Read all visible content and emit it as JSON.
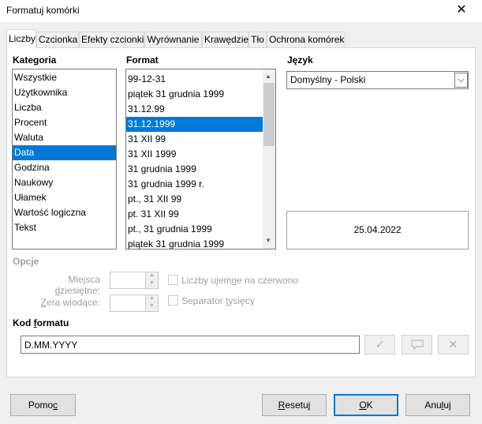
{
  "window": {
    "title": "Formatuj komórki",
    "close_glyph": "✕"
  },
  "tabs": [
    {
      "label": "Liczby"
    },
    {
      "label": "Czcionka"
    },
    {
      "label": "Efekty czcionki"
    },
    {
      "label": "Wyrównanie"
    },
    {
      "label": "Krawędzie"
    },
    {
      "label": "Tło"
    },
    {
      "label": "Ochrona komórek"
    }
  ],
  "category": {
    "label": "Kategoria",
    "items": [
      "Wszystkie",
      "Użytkownika",
      "Liczba",
      "Procent",
      "Waluta",
      "Data",
      "Godzina",
      "Naukowy",
      "Ułamek",
      "Wartość logiczna",
      "Tekst"
    ],
    "selected": "Data"
  },
  "format": {
    "label": "Format",
    "items": [
      "99-12-31",
      "piątek 31 grudnia 1999",
      "31.12.99",
      "31.12.1999",
      "31 XII 99",
      "31 XII 1999",
      "31 grudnia 1999",
      "31 grudnia 1999 r.",
      "pt., 31 XII 99",
      "pt. 31 XII 99",
      "pt., 31 grudnia 1999",
      "piątek 31 grudnia 1999"
    ],
    "selected": "31.12.1999"
  },
  "language": {
    "label": "Język",
    "value": "Domyślny - Polski"
  },
  "preview": {
    "value": "25.04.2022"
  },
  "options": {
    "label": "Opcje",
    "decimal_label": "Miejsca dziesiętne:",
    "leading_zeros_label": "Zera wiodące:",
    "negative_red_label": "Liczby ujemne na czerwono",
    "thousands_sep_label": "Separator tysięcy"
  },
  "format_code": {
    "label": "Kod formatu",
    "value": "D.MM.YYYY"
  },
  "buttons": {
    "help": "Pomoc",
    "reset": "Resetuj",
    "ok": "OK",
    "cancel": "Anuluj"
  },
  "colors": {
    "accent": "#0078d7",
    "disabled": "#a0a0a0"
  },
  "icons": {
    "accept": "check-icon",
    "comment": "comment-icon",
    "delete": "delete-icon"
  }
}
